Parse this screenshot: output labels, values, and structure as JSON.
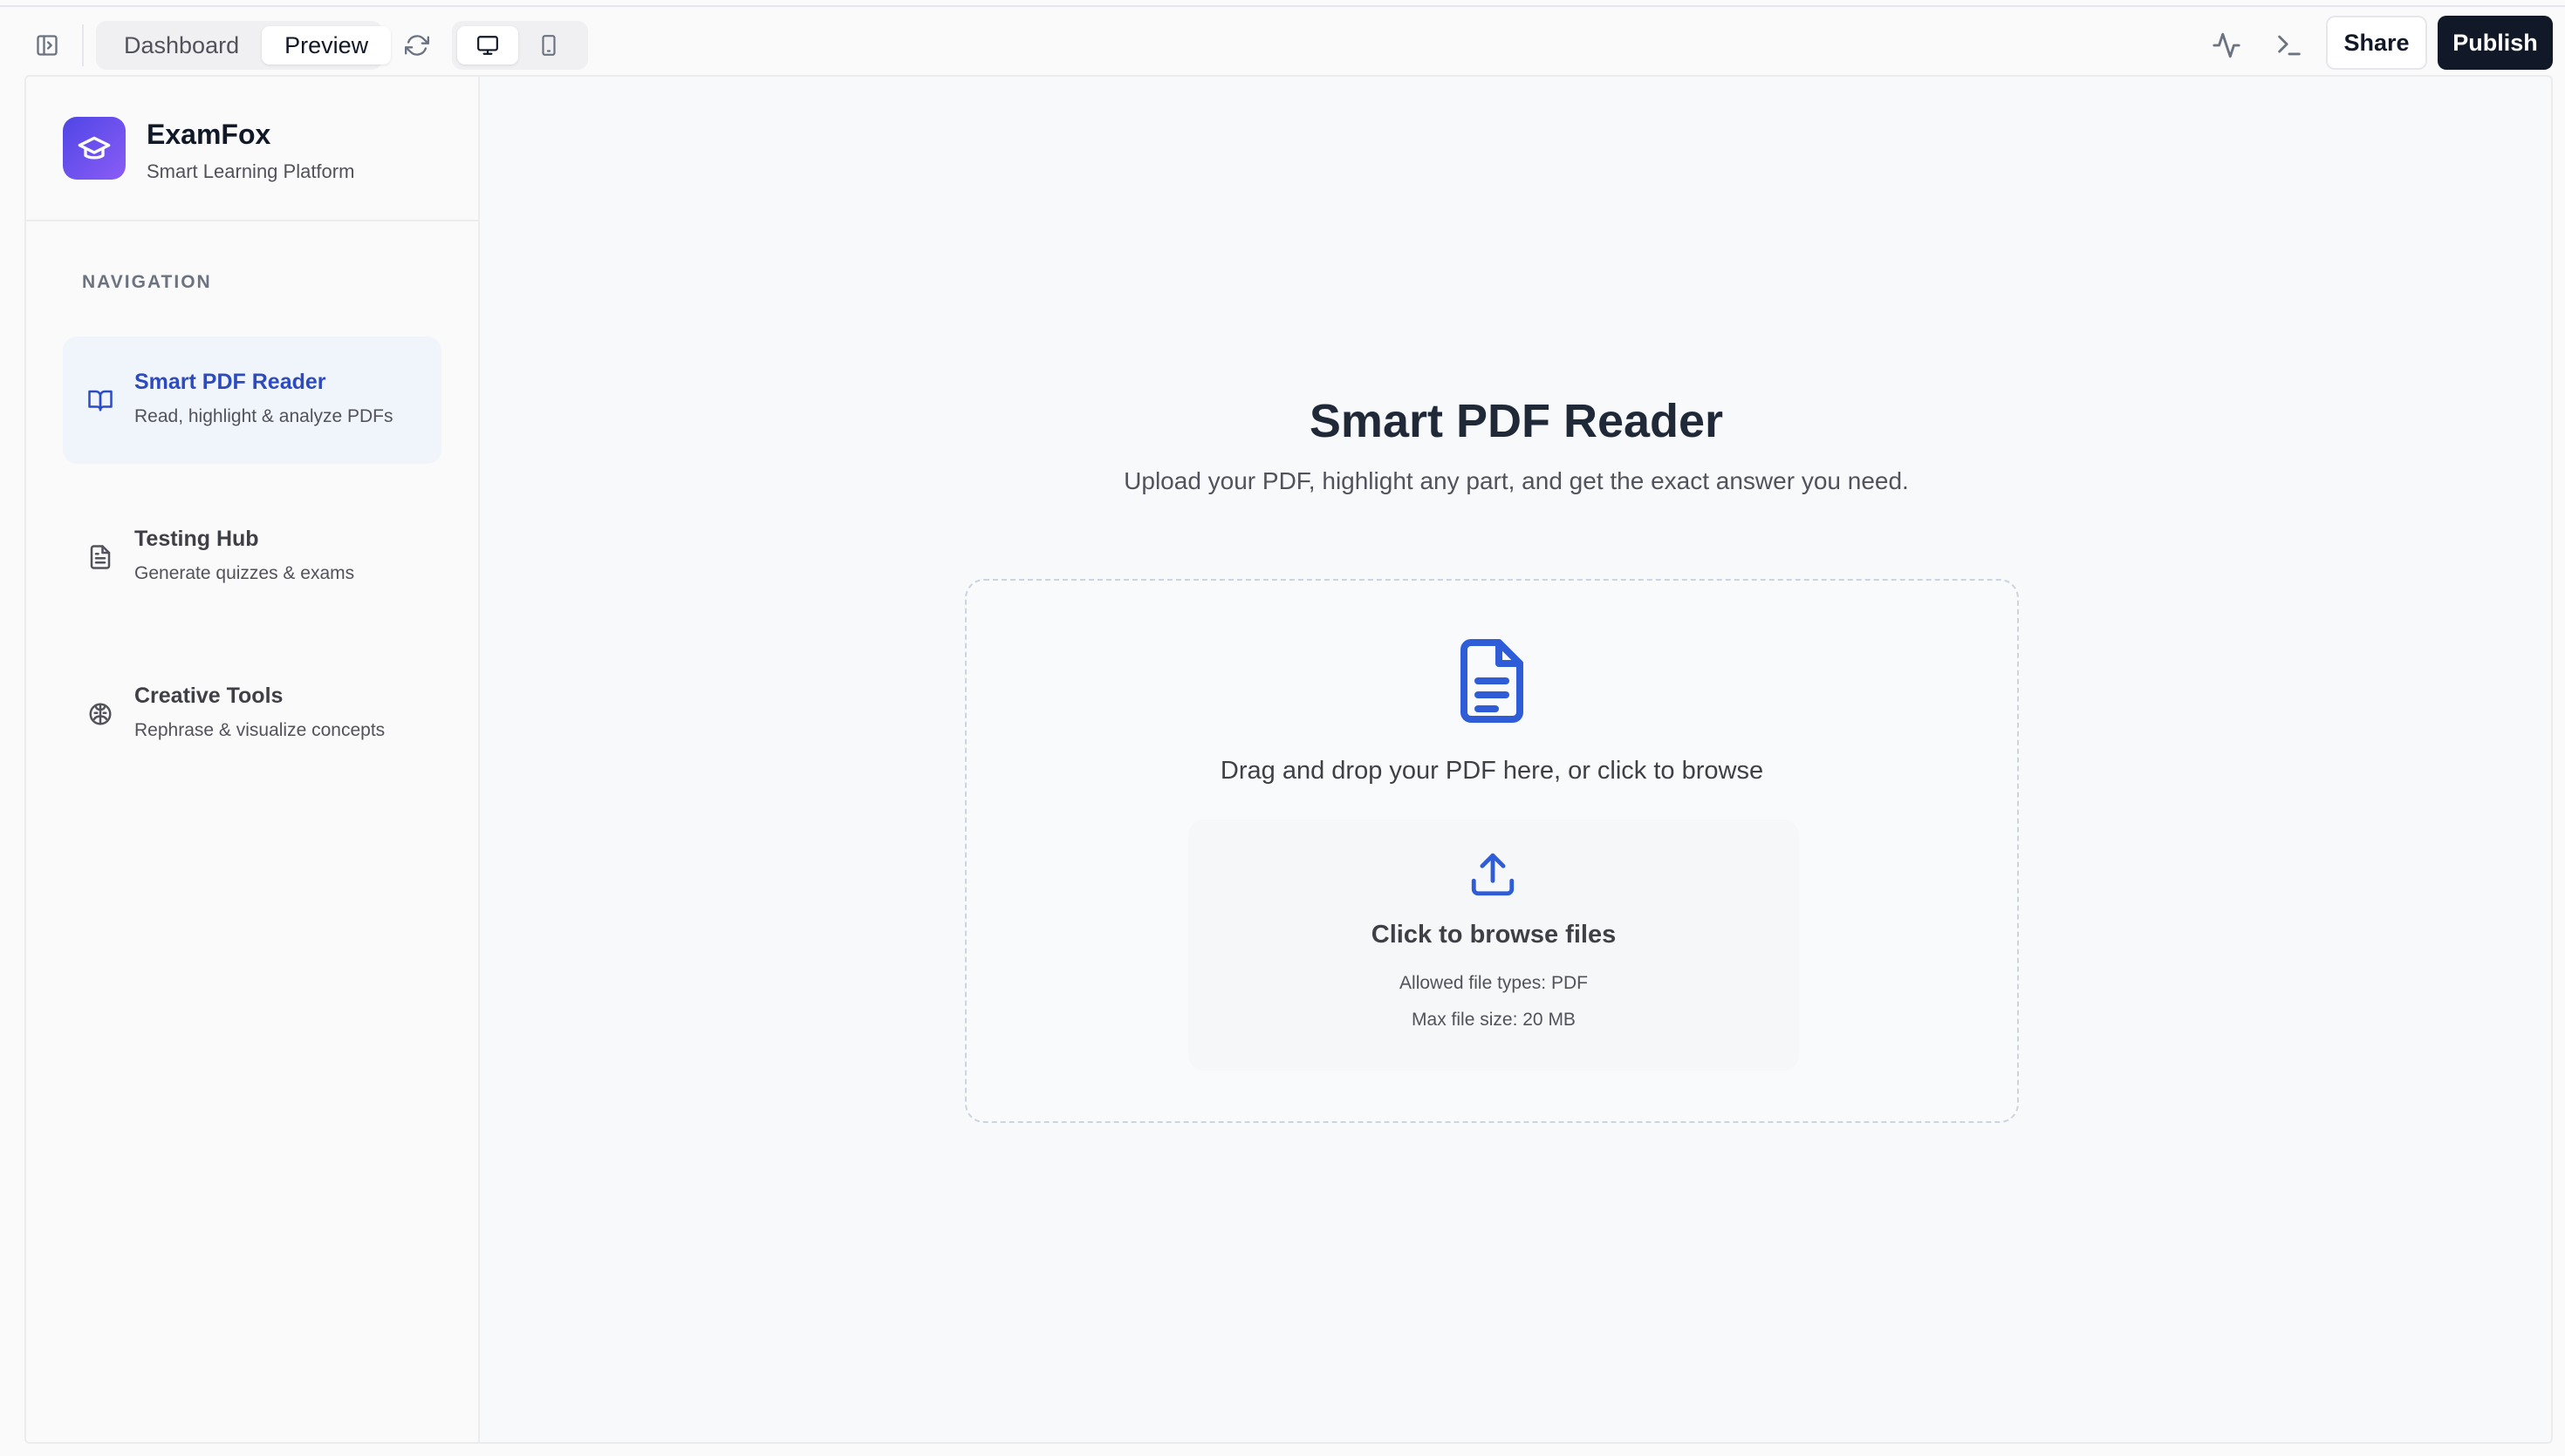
{
  "toolbar": {
    "view_tabs": [
      "Dashboard",
      "Preview"
    ],
    "active_view": "Preview",
    "share_label": "Share",
    "publish_label": "Publish",
    "icons": [
      "sidebar-toggle-icon",
      "refresh-icon",
      "desktop-icon",
      "mobile-icon",
      "activity-icon",
      "terminal-icon"
    ]
  },
  "sidebar": {
    "brand": {
      "name": "ExamFox",
      "tagline": "Smart Learning Platform",
      "logo_icon": "graduation-cap-icon"
    },
    "heading": "NAVIGATION",
    "items": [
      {
        "title": "Smart PDF Reader",
        "subtitle": "Read, highlight & analyze PDFs",
        "icon": "book-open-icon",
        "active": true
      },
      {
        "title": "Testing Hub",
        "subtitle": "Generate quizzes & exams",
        "icon": "file-text-icon",
        "active": false
      },
      {
        "title": "Creative Tools",
        "subtitle": "Rephrase & visualize concepts",
        "icon": "brain-icon",
        "active": false
      }
    ]
  },
  "main": {
    "title": "Smart PDF Reader",
    "subtitle": "Upload your PDF, highlight any part, and get the exact answer you need.",
    "dropzone": {
      "prompt": "Drag and drop your PDF here, or click to browse",
      "browse_title": "Click to browse files",
      "allowed_types": "Allowed file types: PDF",
      "max_size": "Max file size: 20 MB"
    }
  },
  "colors": {
    "accent": "#2f5dd8",
    "active_nav_bg": "#f0f4fb",
    "logo_gradient_start": "#4f46e5",
    "logo_gradient_end": "#8b5cf6",
    "publish_bg": "#111827"
  }
}
